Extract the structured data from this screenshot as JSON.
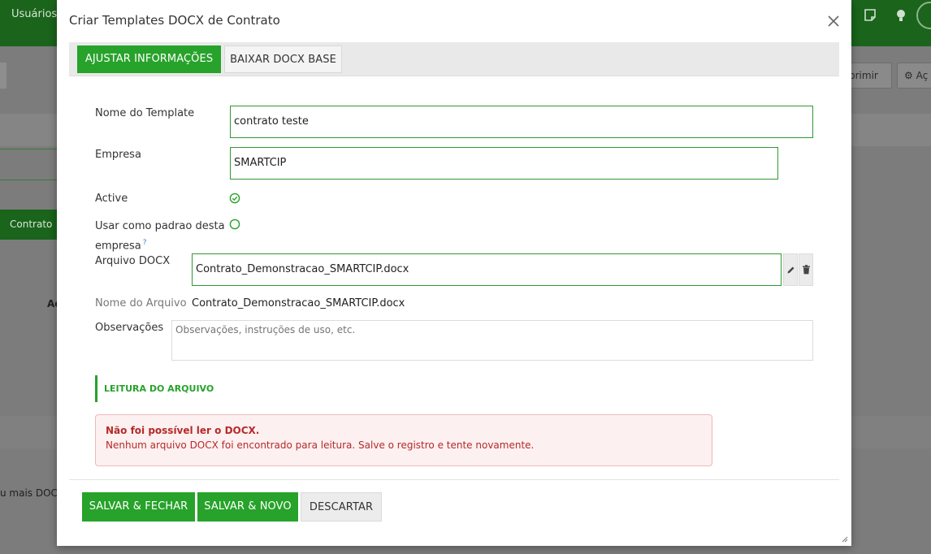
{
  "background": {
    "topbar_menu": "Usuários",
    "right_button_1": "primir",
    "right_button_2": "Aç",
    "left_tab": "Contrato",
    "left_text_1": "Ac",
    "left_text_2": "u mais DOC"
  },
  "modal": {
    "title": "Criar Templates DOCX de Contrato",
    "tabs": [
      {
        "label": "AJUSTAR INFORMAÇÕES",
        "active": true
      },
      {
        "label": "BAIXAR DOCX BASE",
        "active": false
      }
    ],
    "fields": {
      "template_name_label": "Nome do Template",
      "template_name_value": "contrato teste",
      "company_label": "Empresa",
      "company_value": "SMARTCIP",
      "active_label": "Active",
      "default_label_1": "Usar como padrao desta",
      "default_label_2": "empresa",
      "help_mark": "?",
      "docx_file_label": "Arquivo DOCX",
      "docx_file_value": "Contrato_Demonstracao_SMARTCIP.docx",
      "file_name_label": "Nome do Arquivo",
      "file_name_value": "Contrato_Demonstracao_SMARTCIP.docx",
      "notes_label": "Observações",
      "notes_placeholder": "Observações, instruções de uso, etc."
    },
    "section_title": "LEITURA DO ARQUIVO",
    "alert": {
      "title": "Não foi possível ler o DOCX.",
      "message": "Nenhum arquivo DOCX foi encontrado para leitura. Salve o registro e tente novamente."
    },
    "footer": {
      "save_close": "SALVAR & FECHAR",
      "save_new": "SALVAR & NOVO",
      "discard": "DESCARTAR"
    }
  },
  "colors": {
    "primary_green": "#27a22a",
    "topbar_green": "#1a641b",
    "error_red": "#b52a2a"
  }
}
